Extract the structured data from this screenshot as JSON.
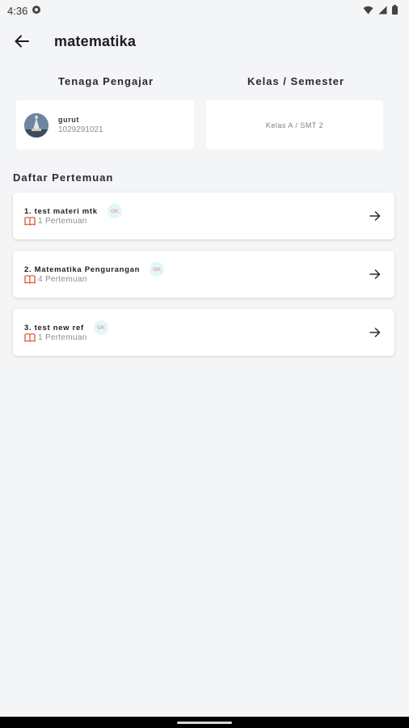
{
  "status_bar": {
    "time": "4:36"
  },
  "header": {
    "title": "matematika"
  },
  "teacher_section": {
    "label": "Tenaga Pengajar",
    "name": "gurut",
    "id": "1029291021"
  },
  "class_section": {
    "label": "Kelas / Semester",
    "value": "Kelas A / SMT 2"
  },
  "meetings": {
    "label": "Daftar Pertemuan",
    "items": [
      {
        "title": "1. test materi mtk",
        "badge": "OK",
        "count": "1 Pertemuan"
      },
      {
        "title": "2. Matematika Pengurangan",
        "badge": "OK",
        "count": "4 Pertemuan"
      },
      {
        "title": "3. test new ref",
        "badge": "OK",
        "count": "1 Pertemuan"
      }
    ]
  },
  "colors": {
    "background": "#f4f5f7",
    "card": "#ffffff",
    "book_icon": "#e2563a",
    "badge_bg": "#e3f6f9"
  }
}
